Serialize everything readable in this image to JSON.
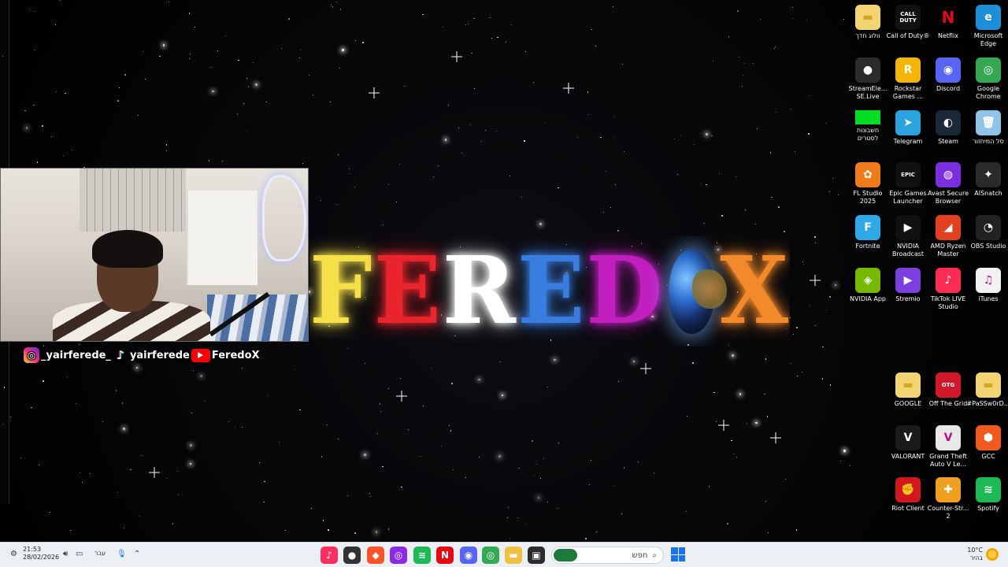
{
  "desktop": {
    "logo": {
      "letters": [
        {
          "char": "F",
          "color": "#f5e04a"
        },
        {
          "char": "E",
          "color": "#e8242c"
        },
        {
          "char": "R",
          "color": "#ffffff"
        },
        {
          "char": "E",
          "color": "#3a7de0"
        },
        {
          "char": "D",
          "color": "#c21fbf"
        }
      ],
      "globe_icon": "earth-globe-icon",
      "last_letter": {
        "char": "X",
        "color": "#f2892a"
      }
    },
    "icons": [
      {
        "label": "וולוג חדך",
        "icon": "folder-icon",
        "color": "#e7c04a",
        "glyph": "▬"
      },
      {
        "label": "Call of Duty®",
        "icon": "call-of-duty-icon",
        "color": "#111111",
        "glyph": "CALL DUTY"
      },
      {
        "label": "Netflix",
        "icon": "netflix-icon",
        "color": "#000000",
        "glyph": "N"
      },
      {
        "label": "Microsoft Edge",
        "icon": "edge-icon",
        "color": "#1c8fd8",
        "glyph": "e"
      },
      {
        "label": "StreamEle... SE.Live",
        "icon": "streamelements-icon",
        "color": "#2b2b2b",
        "glyph": "●"
      },
      {
        "label": "Rockstar Games ...",
        "icon": "rockstar-icon",
        "color": "#f4b400",
        "glyph": "R"
      },
      {
        "label": "Discord",
        "icon": "discord-icon",
        "color": "#5865f2",
        "glyph": "◉"
      },
      {
        "label": "Google Chrome",
        "icon": "chrome-icon",
        "color": "#34a853",
        "glyph": "◎"
      },
      {
        "label": "חשבונות לסטרים",
        "icon": "green-screen-icon",
        "color": "#00dd22",
        "glyph": ""
      },
      {
        "label": "Telegram",
        "icon": "telegram-icon",
        "color": "#2aa3df",
        "glyph": "➤"
      },
      {
        "label": "Steam",
        "icon": "steam-icon",
        "color": "#1b2838",
        "glyph": "◐"
      },
      {
        "label": "סל המיחזור",
        "icon": "recycle-bin-icon",
        "color": "#8fc3e8",
        "glyph": "🗑"
      },
      {
        "label": "FL Studio 2025",
        "icon": "fl-studio-icon",
        "color": "#f07b1c",
        "glyph": "✿"
      },
      {
        "label": "Epic Games Launcher",
        "icon": "epic-games-icon",
        "color": "#111111",
        "glyph": "EPIC"
      },
      {
        "label": "Avast Secure Browser",
        "icon": "avast-browser-icon",
        "color": "#7b2fe0",
        "glyph": "◍"
      },
      {
        "label": "AISnatch",
        "icon": "aisnatch-icon",
        "color": "#2a2a2a",
        "glyph": "✦"
      },
      {
        "label": "Fortnite",
        "icon": "fortnite-icon",
        "color": "#2fa8e8",
        "glyph": "F"
      },
      {
        "label": "NVIDIA Broadcast",
        "icon": "nvidia-broadcast-icon",
        "color": "#111111",
        "glyph": "▶"
      },
      {
        "label": "AMD Ryzen Master",
        "icon": "amd-ryzen-icon",
        "color": "#e04020",
        "glyph": "◢"
      },
      {
        "label": "OBS Studio",
        "icon": "obs-icon",
        "color": "#222222",
        "glyph": "◔"
      },
      {
        "label": "NVIDIA App",
        "icon": "nvidia-app-icon",
        "color": "#76b900",
        "glyph": "◈"
      },
      {
        "label": "Stremio",
        "icon": "stremio-icon",
        "color": "#7b3fe0",
        "glyph": "▶"
      },
      {
        "label": "TikTok LIVE Studio",
        "icon": "tiktok-live-icon",
        "color": "#fe2c55",
        "glyph": "♪"
      },
      {
        "label": "iTunes",
        "icon": "itunes-icon",
        "color": "#f2f2f2",
        "glyph": "♫"
      },
      {
        "label": "GOOGLE",
        "icon": "folder-icon",
        "color": "#f0c040",
        "glyph": "▬"
      },
      {
        "label": "Off The Grid",
        "icon": "off-the-grid-icon",
        "color": "#d0182a",
        "glyph": "OTG"
      },
      {
        "label": "#PaSSw0rD...",
        "icon": "folder-icon",
        "color": "#f0c040",
        "glyph": "▬"
      },
      {
        "label": "VALORANT",
        "icon": "valorant-icon",
        "color": "#1a1a1a",
        "glyph": "V"
      },
      {
        "label": "Grand Theft Auto V Le...",
        "icon": "gta-v-icon",
        "color": "#e8e8e8",
        "glyph": "V"
      },
      {
        "label": "GCC",
        "icon": "gcc-icon",
        "color": "#f05a1e",
        "glyph": "⬢"
      },
      {
        "label": "Riot Client",
        "icon": "riot-client-icon",
        "color": "#d3171f",
        "glyph": "✊"
      },
      {
        "label": "Counter-Str... 2",
        "icon": "counter-strike-icon",
        "color": "#f0a020",
        "glyph": "✚"
      },
      {
        "label": "Spotify",
        "icon": "spotify-icon",
        "color": "#1db954",
        "glyph": "≋"
      }
    ]
  },
  "overlay": {
    "instagram": "_yairferede_",
    "tiktok": "yairferede",
    "youtube": "FeredoX"
  },
  "taskbar": {
    "clock_time": "21:53",
    "clock_date": "28/02/2026",
    "language": "עבר",
    "search_placeholder": "חפש",
    "weather_temp": "10°C",
    "weather_desc": "בהיר",
    "apps": [
      {
        "name": "tiktok",
        "color": "#ff2f62",
        "glyph": "♪"
      },
      {
        "name": "recorder",
        "color": "#333333",
        "glyph": "●"
      },
      {
        "name": "brave",
        "color": "#fb542b",
        "glyph": "◆"
      },
      {
        "name": "stream-app",
        "color": "#8a2be2",
        "glyph": "◎"
      },
      {
        "name": "spotify",
        "color": "#1db954",
        "glyph": "≋"
      },
      {
        "name": "netflix",
        "color": "#e50914",
        "glyph": "N"
      },
      {
        "name": "discord",
        "color": "#5865f2",
        "glyph": "◉"
      },
      {
        "name": "chrome",
        "color": "#34a853",
        "glyph": "◎"
      },
      {
        "name": "file-explorer",
        "color": "#f0c040",
        "glyph": "▬"
      },
      {
        "name": "terminal",
        "color": "#2b2b2b",
        "glyph": "▣"
      }
    ]
  }
}
